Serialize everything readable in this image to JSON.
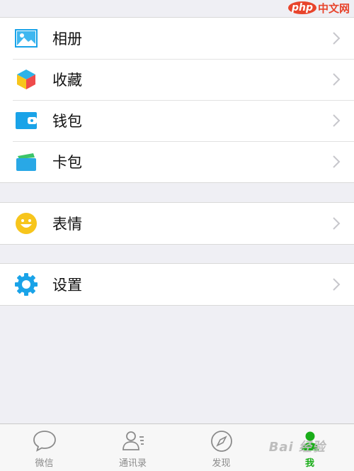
{
  "watermark": {
    "badge": "php",
    "text": "中文网"
  },
  "groups": [
    {
      "items": [
        {
          "label": "相册",
          "icon": "photo-album-icon"
        },
        {
          "label": "收藏",
          "icon": "favorites-cube-icon"
        },
        {
          "label": "钱包",
          "icon": "wallet-icon"
        },
        {
          "label": "卡包",
          "icon": "card-pack-icon"
        }
      ]
    },
    {
      "items": [
        {
          "label": "表情",
          "icon": "emoji-smile-icon"
        }
      ]
    },
    {
      "items": [
        {
          "label": "设置",
          "icon": "settings-gear-icon"
        }
      ]
    }
  ],
  "tabbar": {
    "tabs": [
      {
        "label": "微信",
        "icon": "chat-bubble-icon",
        "active": false
      },
      {
        "label": "通讯录",
        "icon": "contacts-icon",
        "active": false
      },
      {
        "label": "发现",
        "icon": "compass-icon",
        "active": false
      },
      {
        "label": "我",
        "icon": "me-person-icon",
        "active": true
      }
    ],
    "watermark": "Bai 经验"
  },
  "colors": {
    "active": "#1aad19",
    "inactive": "#8b8b8b",
    "background": "#efeff4"
  }
}
